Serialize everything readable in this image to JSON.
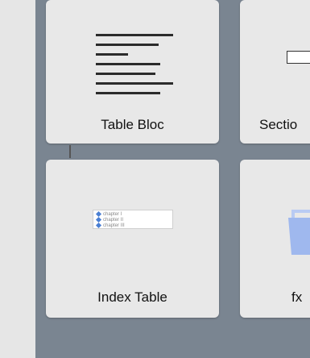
{
  "tiles": [
    {
      "label": "Table Bloc",
      "icon": "text-lines-icon"
    },
    {
      "label": "Sectio",
      "icon": "section-icon"
    },
    {
      "label": "Index Table",
      "icon": "index-table-icon"
    },
    {
      "label": "fx",
      "icon": "formula-icon"
    }
  ],
  "index_preview": {
    "rows": [
      "chapter I",
      "chapter II",
      "chapter III"
    ]
  },
  "colors": {
    "panel_bg": "#7a8591",
    "left_strip": "#e6e6e6",
    "tile_bg": "#e8e8e8",
    "bullet": "#4a7fd3",
    "fx_icon": "#9fb8ee"
  }
}
